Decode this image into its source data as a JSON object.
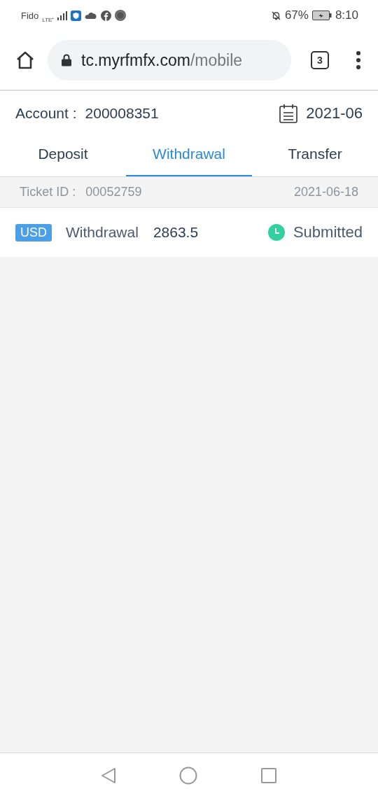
{
  "status_bar": {
    "carrier": "Fido",
    "network": "LTE⁺",
    "battery": "67%",
    "time": "8:10"
  },
  "browser": {
    "url_host": "tc.myrfmfx.com",
    "url_path": "/mobile",
    "tab_count": "3"
  },
  "account": {
    "label": "Account :",
    "number": "200008351",
    "month": "2021-06"
  },
  "tabs": [
    {
      "label": "Deposit",
      "selected": false
    },
    {
      "label": "Withdrawal",
      "selected": true
    },
    {
      "label": "Transfer",
      "selected": false
    }
  ],
  "tickets": [
    {
      "id_label": "Ticket ID :",
      "id": "00052759",
      "date": "2021-06-18",
      "currency": "USD",
      "type": "Withdrawal",
      "amount": "2863.5",
      "status": "Submitted",
      "color": "#33d1a0"
    }
  ]
}
